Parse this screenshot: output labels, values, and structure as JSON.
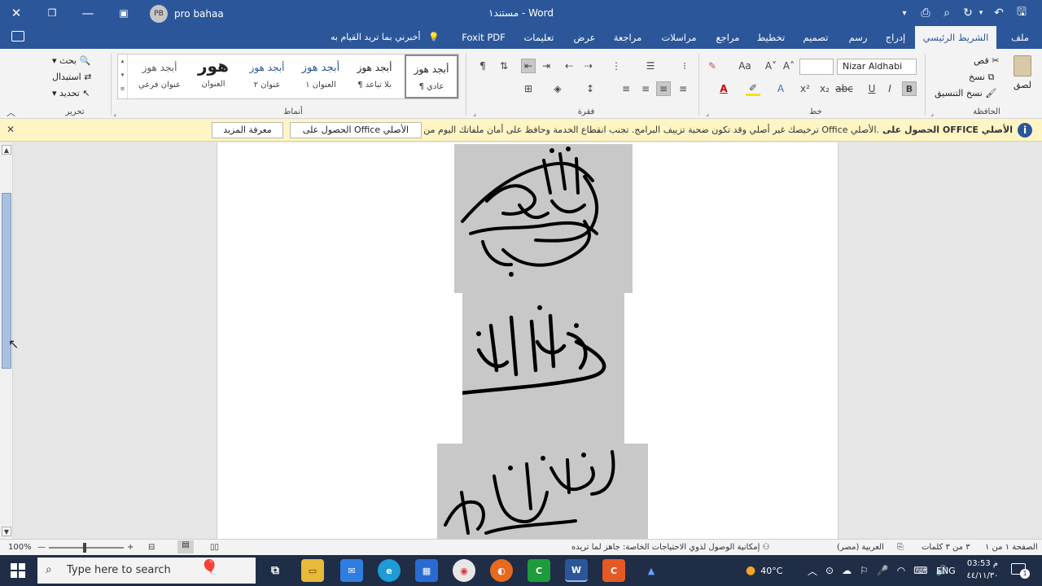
{
  "titlebar": {
    "title": "مستند١ - Word",
    "user_name": "pro bahaa",
    "user_initials": "PB"
  },
  "tabs": [
    {
      "label": "ملف"
    },
    {
      "label": "الشريط الرئيسي"
    },
    {
      "label": "إدراج"
    },
    {
      "label": "رسم"
    },
    {
      "label": "تصميم"
    },
    {
      "label": "تخطيط"
    },
    {
      "label": "مراجع"
    },
    {
      "label": "مراسلات"
    },
    {
      "label": "مراجعة"
    },
    {
      "label": "عرض"
    },
    {
      "label": "تعليمات"
    },
    {
      "label": "Foxit PDF"
    }
  ],
  "tellme": "أخبرني بما تريد القيام به",
  "ribbon": {
    "clipboard": {
      "paste": "لصق",
      "cut": "قص",
      "copy": "نسخ",
      "format_painter": "نسخ التنسيق",
      "group": "الحافظة"
    },
    "font": {
      "font_name": "Nizar Aldhabi",
      "font_size": "",
      "group": "خط"
    },
    "paragraph": {
      "group": "فقرة"
    },
    "styles": {
      "group": "أنماط",
      "items": [
        {
          "sample": "أبجد هوز",
          "name": "¶ عادي"
        },
        {
          "sample": "أبجد هوز",
          "name": "¶ بلا تباعد"
        },
        {
          "sample": "أبجد هوز",
          "name": "العنوان ١"
        },
        {
          "sample": "أبجد هوز",
          "name": "عنوان ٢"
        },
        {
          "sample": "هور",
          "name": "العنوان"
        },
        {
          "sample": "أبجد هوز",
          "name": "عنوان فرعي"
        }
      ]
    },
    "editing": {
      "find": "بحث",
      "replace": "استبدال",
      "select": "تحديد",
      "group": "تحرير"
    }
  },
  "message_bar": {
    "title": "الحصول على OFFICE الأصلي",
    "text": "ترخيصك غير أصلي وقد تكون ضحية تزييف البرامج. تجنب انقطاع الخدمة وحافظ على أمان ملفاتك اليوم من Office الأصلي.",
    "get_button": "الحصول على Office الأصلي",
    "learn_button": "معرفة المزيد"
  },
  "statusbar": {
    "page": "الصفحة ١ من ١",
    "words": "٣ من ٣ كلمات",
    "language": "العربية (مصر)",
    "accessibility": "إمكانية الوصول لذوي الاحتياجات الخاصة: جاهز لما تريده",
    "zoom": "100%"
  },
  "taskbar": {
    "search_placeholder": "Type here to search",
    "weather": "40°C",
    "language": "ENG",
    "time": "03:53 م",
    "date": "٤٤/١١/٣٠",
    "notification_count": "1"
  }
}
